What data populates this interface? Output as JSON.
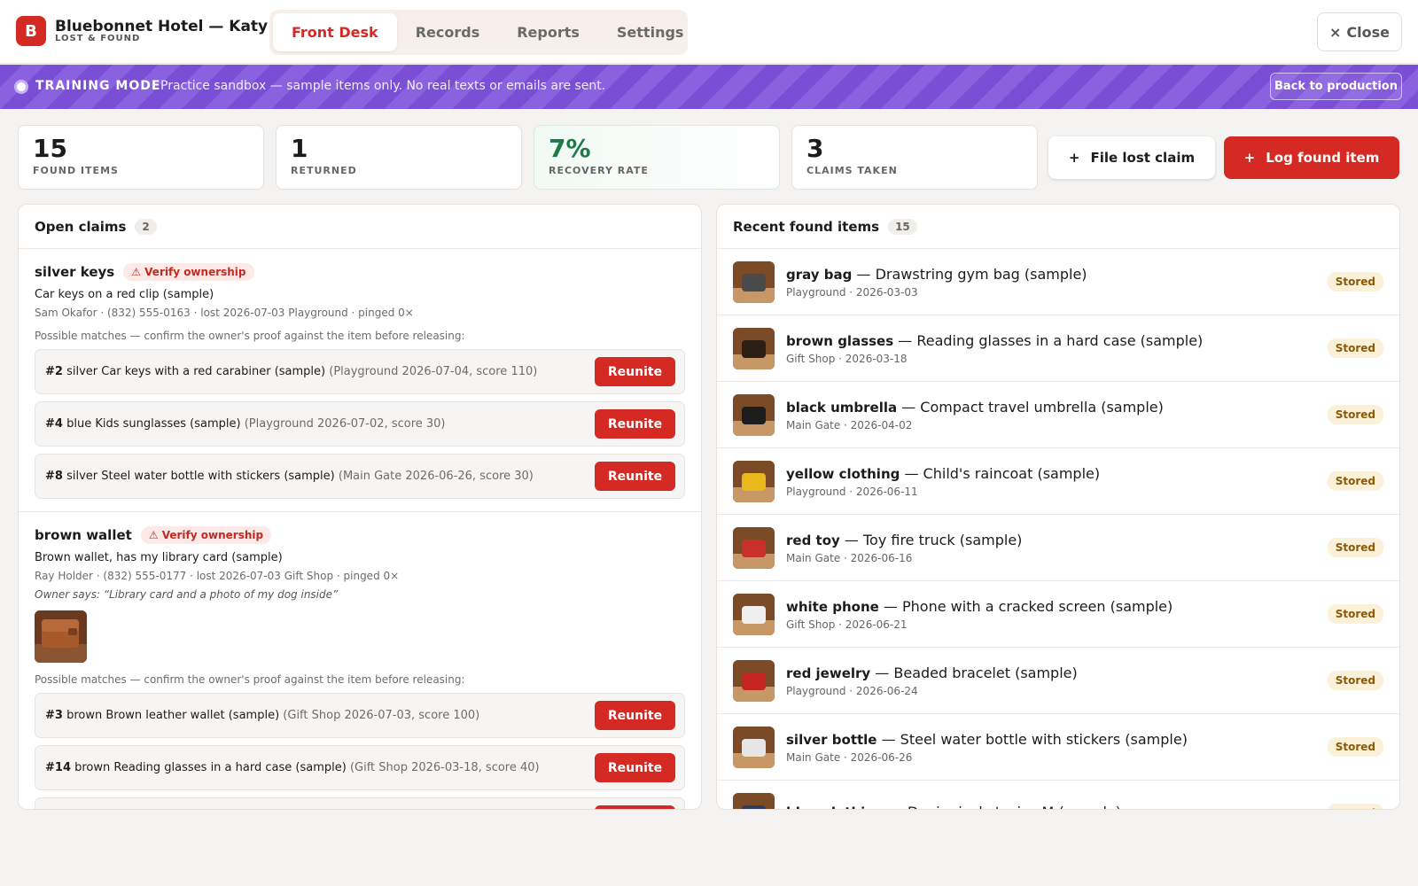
{
  "header": {
    "logo_letter": "B",
    "title": "Bluebonnet Hotel — Katy",
    "subtitle": "LOST & FOUND",
    "tabs": [
      {
        "label": "Front Desk",
        "active": true
      },
      {
        "label": "Records",
        "active": false
      },
      {
        "label": "Reports",
        "active": false
      },
      {
        "label": "Settings",
        "active": false
      }
    ],
    "close_icon": "×",
    "close_label": "Close"
  },
  "banner": {
    "label": "TRAINING MODE",
    "text": "Practice sandbox — sample items only. No real texts or emails are sent.",
    "button": "Back to production"
  },
  "stats": [
    {
      "value": "15",
      "label": "FOUND ITEMS"
    },
    {
      "value": "1",
      "label": "RETURNED"
    },
    {
      "value": "7%",
      "label": "RECOVERY RATE"
    },
    {
      "value": "3",
      "label": "CLAIMS TAKEN"
    }
  ],
  "actions": {
    "claim_icon": "+",
    "claim_label": "File lost claim",
    "found_icon": "+",
    "found_label": "Log found item"
  },
  "open_claims": {
    "title": "Open claims",
    "count": "2",
    "verify_label": "⚠ Verify ownership",
    "matches_note": "Possible matches — confirm the owner's proof against the item before releasing:",
    "reunite_label": "Reunite",
    "claims": [
      {
        "name": "silver keys",
        "desc": "Car keys on a red clip (sample)",
        "meta": "Sam Okafor · (832) 555-0163 · lost 2026-07-03 Playground · pinged 0×",
        "matches": [
          {
            "num": "#2",
            "text": "silver Car keys with a red carabiner (sample)",
            "extra": "(Playground 2026-07-04, score 110)"
          },
          {
            "num": "#4",
            "text": "blue Kids sunglasses (sample)",
            "extra": "(Playground 2026-07-02, score 30)"
          },
          {
            "num": "#8",
            "text": "silver Steel water bottle with stickers (sample)",
            "extra": "(Main Gate 2026-06-26, score 30)"
          }
        ]
      },
      {
        "name": "brown wallet",
        "desc": "Brown wallet, has my library card (sample)",
        "meta": "Ray Holder · (832) 555-0177 · lost 2026-07-03 Gift Shop · pinged 0×",
        "owner_says": "Owner says: “Library card and a photo of my dog inside”",
        "matches": [
          {
            "num": "#3",
            "text": "brown Brown leather wallet (sample)",
            "extra": "(Gift Shop 2026-07-03, score 100)"
          },
          {
            "num": "#14",
            "text": "brown Reading glasses in a hard case (sample)",
            "extra": "(Gift Shop 2026-03-18, score 40)"
          }
        ]
      }
    ]
  },
  "found_items": {
    "title": "Recent found items",
    "count": "15",
    "status_label": "Stored",
    "items": [
      {
        "tag": "gray bag",
        "desc": "— Drawstring gym bag (sample)",
        "meta": "Playground · 2026-03-03",
        "color": "#4a4a4a"
      },
      {
        "tag": "brown glasses",
        "desc": "— Reading glasses in a hard case (sample)",
        "meta": "Gift Shop · 2026-03-18",
        "color": "#2b1e15"
      },
      {
        "tag": "black umbrella",
        "desc": "— Compact travel umbrella (sample)",
        "meta": "Main Gate · 2026-04-02",
        "color": "#1d1d1d"
      },
      {
        "tag": "yellow clothing",
        "desc": "— Child's raincoat (sample)",
        "meta": "Playground · 2026-06-11",
        "color": "#e8b81c"
      },
      {
        "tag": "red toy",
        "desc": "— Toy fire truck (sample)",
        "meta": "Main Gate · 2026-06-16",
        "color": "#c8302a"
      },
      {
        "tag": "white phone",
        "desc": "— Phone with a cracked screen (sample)",
        "meta": "Gift Shop · 2026-06-21",
        "color": "#efefef"
      },
      {
        "tag": "red jewelry",
        "desc": "— Beaded bracelet (sample)",
        "meta": "Playground · 2026-06-24",
        "color": "#c42520"
      },
      {
        "tag": "silver bottle",
        "desc": "— Steel water bottle with stickers (sample)",
        "meta": "Main Gate · 2026-06-26",
        "color": "#e6e6e6"
      },
      {
        "tag": "blue clothing",
        "desc": "— Denim jacket, size M (sample)",
        "meta": "",
        "color": "#2d3e5c"
      }
    ]
  },
  "colors": {
    "brand_red": "#d42a23",
    "training_purple": "#7a4fd6",
    "recovery_green": "#1e7a46",
    "stored_amber": "#fbf0d8"
  }
}
